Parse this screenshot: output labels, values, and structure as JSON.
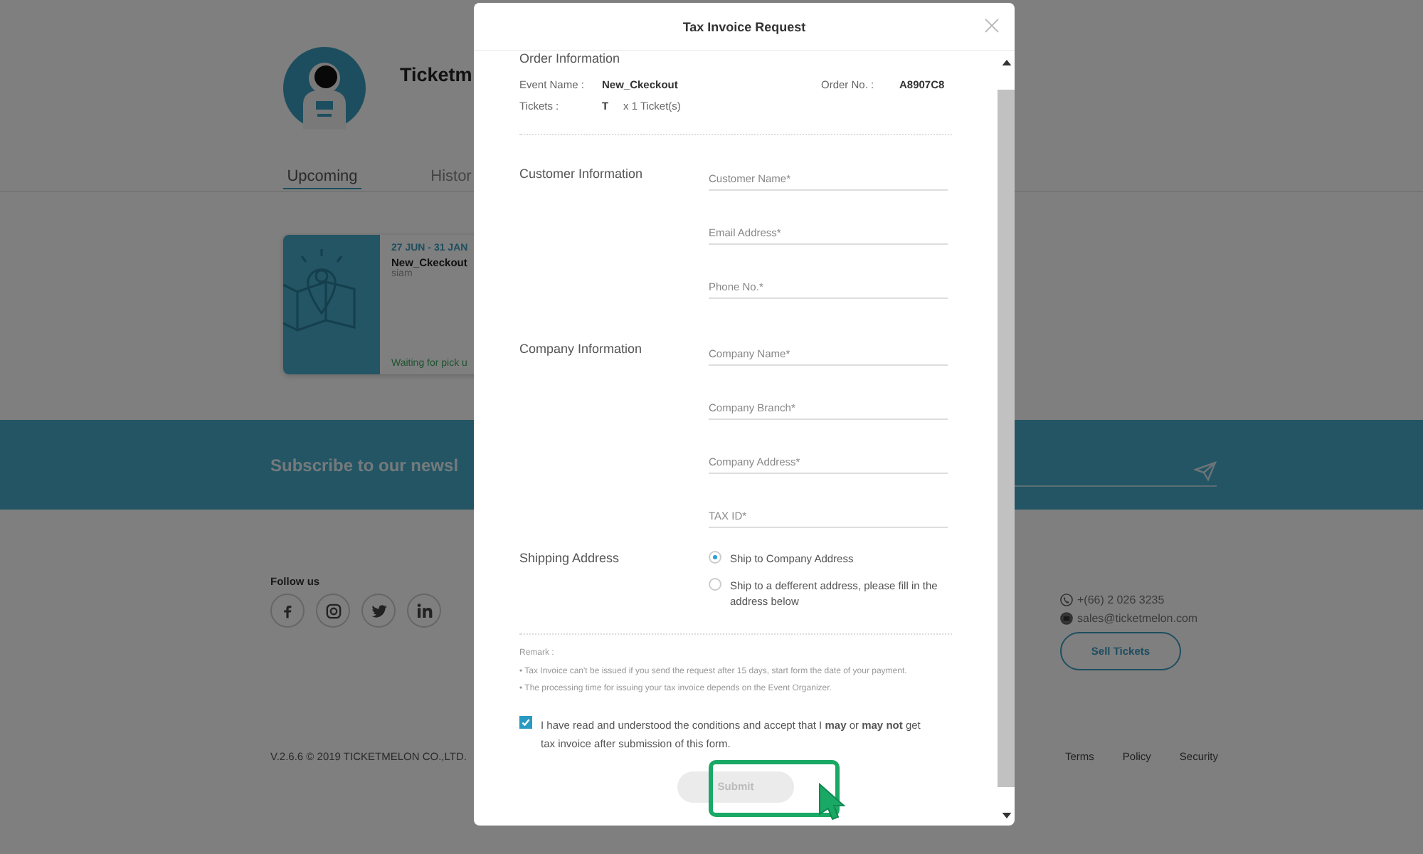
{
  "background_page": {
    "profile": {
      "name": "Ticketm"
    },
    "tabs": [
      {
        "label": "Upcoming",
        "selected": true
      },
      {
        "label": "Histor",
        "selected": false
      }
    ],
    "event_card": {
      "date": "27 JUN - 31 JAN",
      "title": "New_Ckeckout",
      "venue": "siam",
      "status": "Waiting for pick u"
    },
    "newsletter": {
      "heading": "Subscribe to our newsl"
    },
    "footer": {
      "follow_heading": "Follow us",
      "phone": "+(66) 2 026 3235",
      "email": "sales@ticketmelon.com",
      "sell_button": "Sell Tickets",
      "copyright": "V.2.6.6 © 2019 TICKETMELON CO.,LTD.",
      "links": [
        "Terms",
        "Policy",
        "Security"
      ]
    }
  },
  "dialog": {
    "title": "Tax Invoice Request",
    "order": {
      "heading": "Order Information",
      "event_label": "Event Name :",
      "event_value": "New_Ckeckout",
      "order_label": "Order No. :",
      "order_value": "A8907C8",
      "tickets_label": "Tickets :",
      "ticket_type": "T",
      "ticket_count": "x 1 Ticket(s)"
    },
    "sections": [
      {
        "heading": "Customer Information",
        "fields": [
          {
            "placeholder": "Customer Name*"
          },
          {
            "placeholder": "Email Address*"
          },
          {
            "placeholder": "Phone No.*"
          }
        ]
      },
      {
        "heading": "Company Information",
        "fields": [
          {
            "placeholder": "Company Name*"
          },
          {
            "placeholder": "Company Branch*"
          },
          {
            "placeholder": "Company Address*"
          },
          {
            "placeholder": "TAX ID*"
          }
        ]
      }
    ],
    "shipping": {
      "heading": "Shipping Address",
      "options": [
        {
          "label": "Ship to Company Address",
          "selected": true
        },
        {
          "label": "Ship to a defferent address, please fill in the address below",
          "selected": false
        }
      ]
    },
    "remark": {
      "heading": "Remark :",
      "lines": [
        "• Tax Invoice can't be issued if you send the request after 15 days, start form the date of your payment.",
        "• The processing time for issuing your tax invoice depends on the Event Organizer."
      ]
    },
    "consent": {
      "text": "I have read and understood the conditions and accept that I **may** or **may not** get tax invoice after submission of this form.",
      "checked": true
    },
    "submit": {
      "label": "Submit",
      "disabled": true
    }
  }
}
